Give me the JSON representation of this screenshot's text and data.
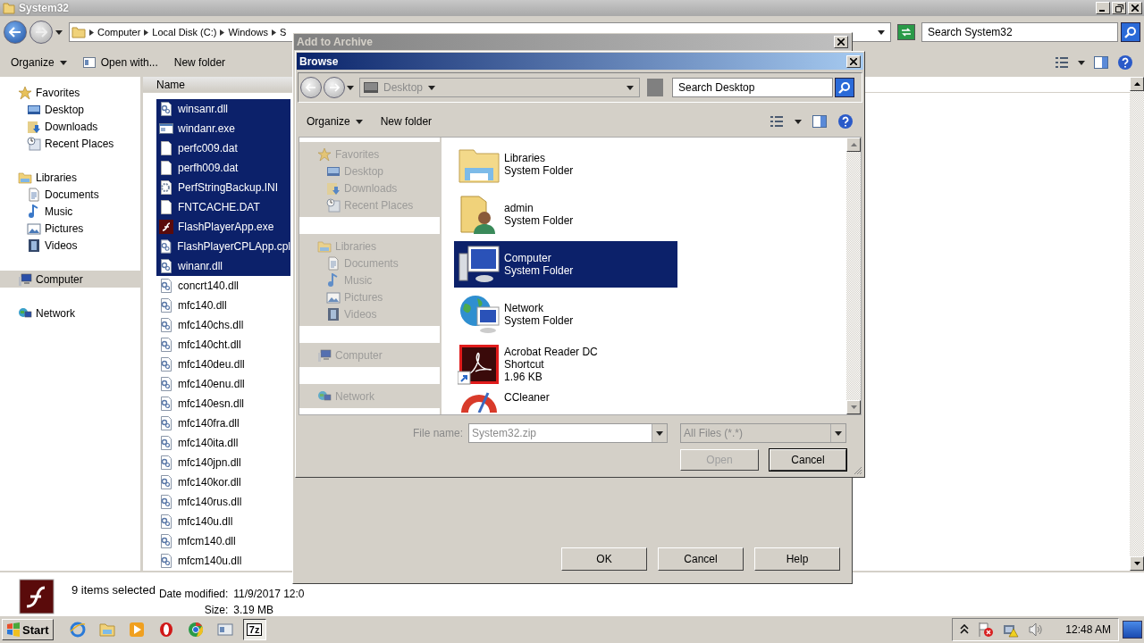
{
  "explorer": {
    "title": "System32",
    "breadcrumbs": [
      "Computer",
      "Local Disk (C:)",
      "Windows",
      "S"
    ],
    "search_placeholder": "Search System32",
    "toolbar": [
      {
        "label": "Organize",
        "kind": "menu"
      },
      {
        "label": "Open with...",
        "kind": "open-with"
      },
      {
        "label": "New folder",
        "kind": "plain"
      }
    ],
    "nav": [
      {
        "label": "Favorites",
        "kind": "favorites",
        "selected": false,
        "children": [
          {
            "label": "Desktop",
            "kind": "desktop",
            "selected": false
          },
          {
            "label": "Downloads",
            "kind": "downloads",
            "selected": false
          },
          {
            "label": "Recent Places",
            "kind": "recent",
            "selected": false
          }
        ]
      },
      {
        "label": "Libraries",
        "kind": "libraries",
        "selected": false,
        "children": [
          {
            "label": "Documents",
            "kind": "documents",
            "selected": false
          },
          {
            "label": "Music",
            "kind": "music",
            "selected": false
          },
          {
            "label": "Pictures",
            "kind": "pictures",
            "selected": false
          },
          {
            "label": "Videos",
            "kind": "videos",
            "selected": false
          }
        ]
      },
      {
        "label": "Computer",
        "kind": "computer",
        "selected": true
      },
      {
        "label": "Network",
        "kind": "network",
        "selected": false
      }
    ],
    "column": "Name",
    "files": [
      {
        "name": "winsanr.dll",
        "kind": "dll",
        "selected": true
      },
      {
        "name": "windanr.exe",
        "kind": "exe",
        "selected": true
      },
      {
        "name": "perfc009.dat",
        "kind": "dat",
        "selected": true
      },
      {
        "name": "perfh009.dat",
        "kind": "dat",
        "selected": true
      },
      {
        "name": "PerfStringBackup.INI",
        "kind": "ini",
        "selected": true
      },
      {
        "name": "FNTCACHE.DAT",
        "kind": "dat",
        "selected": true
      },
      {
        "name": "FlashPlayerApp.exe",
        "kind": "flash",
        "selected": true
      },
      {
        "name": "FlashPlayerCPLApp.cpl",
        "kind": "dll",
        "selected": true
      },
      {
        "name": "winanr.dll",
        "kind": "dll",
        "selected": true
      },
      {
        "name": "concrt140.dll",
        "kind": "dll",
        "selected": false
      },
      {
        "name": "mfc140.dll",
        "kind": "dll",
        "selected": false
      },
      {
        "name": "mfc140chs.dll",
        "kind": "dll",
        "selected": false
      },
      {
        "name": "mfc140cht.dll",
        "kind": "dll",
        "selected": false
      },
      {
        "name": "mfc140deu.dll",
        "kind": "dll",
        "selected": false
      },
      {
        "name": "mfc140enu.dll",
        "kind": "dll",
        "selected": false
      },
      {
        "name": "mfc140esn.dll",
        "kind": "dll",
        "selected": false
      },
      {
        "name": "mfc140fra.dll",
        "kind": "dll",
        "selected": false
      },
      {
        "name": "mfc140ita.dll",
        "kind": "dll",
        "selected": false
      },
      {
        "name": "mfc140jpn.dll",
        "kind": "dll",
        "selected": false
      },
      {
        "name": "mfc140kor.dll",
        "kind": "dll",
        "selected": false
      },
      {
        "name": "mfc140rus.dll",
        "kind": "dll",
        "selected": false
      },
      {
        "name": "mfc140u.dll",
        "kind": "dll",
        "selected": false
      },
      {
        "name": "mfcm140.dll",
        "kind": "dll",
        "selected": false
      },
      {
        "name": "mfcm140u.dll",
        "kind": "dll",
        "selected": false
      }
    ],
    "details": {
      "summary": "9 items selected",
      "date_label": "Date modified:",
      "date": "11/9/2017 12:0",
      "size_label": "Size:",
      "size": "3.19 MB"
    }
  },
  "archive_dialog": {
    "title": "Add to Archive",
    "buttons": [
      "OK",
      "Cancel",
      "Help"
    ]
  },
  "browse_dialog": {
    "title": "Browse",
    "location": "Desktop",
    "location_disabled": true,
    "search_placeholder": "Search Desktop",
    "toolbar": [
      {
        "label": "Organize",
        "kind": "menu"
      },
      {
        "label": "New folder",
        "kind": "plain"
      }
    ],
    "nav_disabled": true,
    "nav": [
      {
        "label": "Favorites",
        "kind": "favorites",
        "children": [
          {
            "label": "Desktop",
            "kind": "desktop"
          },
          {
            "label": "Downloads",
            "kind": "downloads"
          },
          {
            "label": "Recent Places",
            "kind": "recent"
          }
        ]
      },
      {
        "label": "Libraries",
        "kind": "libraries",
        "children": [
          {
            "label": "Documents",
            "kind": "documents"
          },
          {
            "label": "Music",
            "kind": "music"
          },
          {
            "label": "Pictures",
            "kind": "pictures"
          },
          {
            "label": "Videos",
            "kind": "videos"
          }
        ]
      },
      {
        "label": "Computer",
        "kind": "computer"
      },
      {
        "label": "Network",
        "kind": "network"
      }
    ],
    "items": [
      {
        "kind": "libraries",
        "lines": [
          "Libraries",
          "System Folder"
        ],
        "selected": false
      },
      {
        "kind": "user",
        "lines": [
          "admin",
          "System Folder"
        ],
        "selected": false
      },
      {
        "kind": "computer",
        "lines": [
          "Computer",
          "System Folder"
        ],
        "selected": true
      },
      {
        "kind": "network",
        "lines": [
          "Network",
          "System Folder"
        ],
        "selected": false
      },
      {
        "kind": "acrobat",
        "lines": [
          "Acrobat Reader DC",
          "Shortcut",
          "1.96 KB"
        ],
        "selected": false
      },
      {
        "kind": "ccleaner",
        "lines": [
          "CCleaner"
        ],
        "selected": false
      }
    ],
    "file_name_label": "File name:",
    "file_name": {
      "value": "System32.zip",
      "disabled": true
    },
    "filter": {
      "value": "All Files (*.*)",
      "disabled": true
    },
    "buttons": [
      {
        "label": "Open",
        "disabled": true
      },
      {
        "label": "Cancel",
        "disabled": false
      }
    ]
  },
  "taskbar": {
    "start": "Start",
    "apps": [
      {
        "kind": "ie",
        "selected": false
      },
      {
        "kind": "folder",
        "selected": false
      },
      {
        "kind": "media",
        "selected": false
      },
      {
        "kind": "opera",
        "selected": false
      },
      {
        "kind": "chrome",
        "selected": false
      },
      {
        "kind": "window",
        "selected": false
      },
      {
        "kind": "archiver",
        "label": "7z",
        "selected": true
      }
    ],
    "tray": [
      {
        "kind": "chevron"
      },
      {
        "kind": "flag"
      },
      {
        "kind": "network"
      },
      {
        "kind": "speaker"
      }
    ],
    "clock": "12:48 AM"
  }
}
